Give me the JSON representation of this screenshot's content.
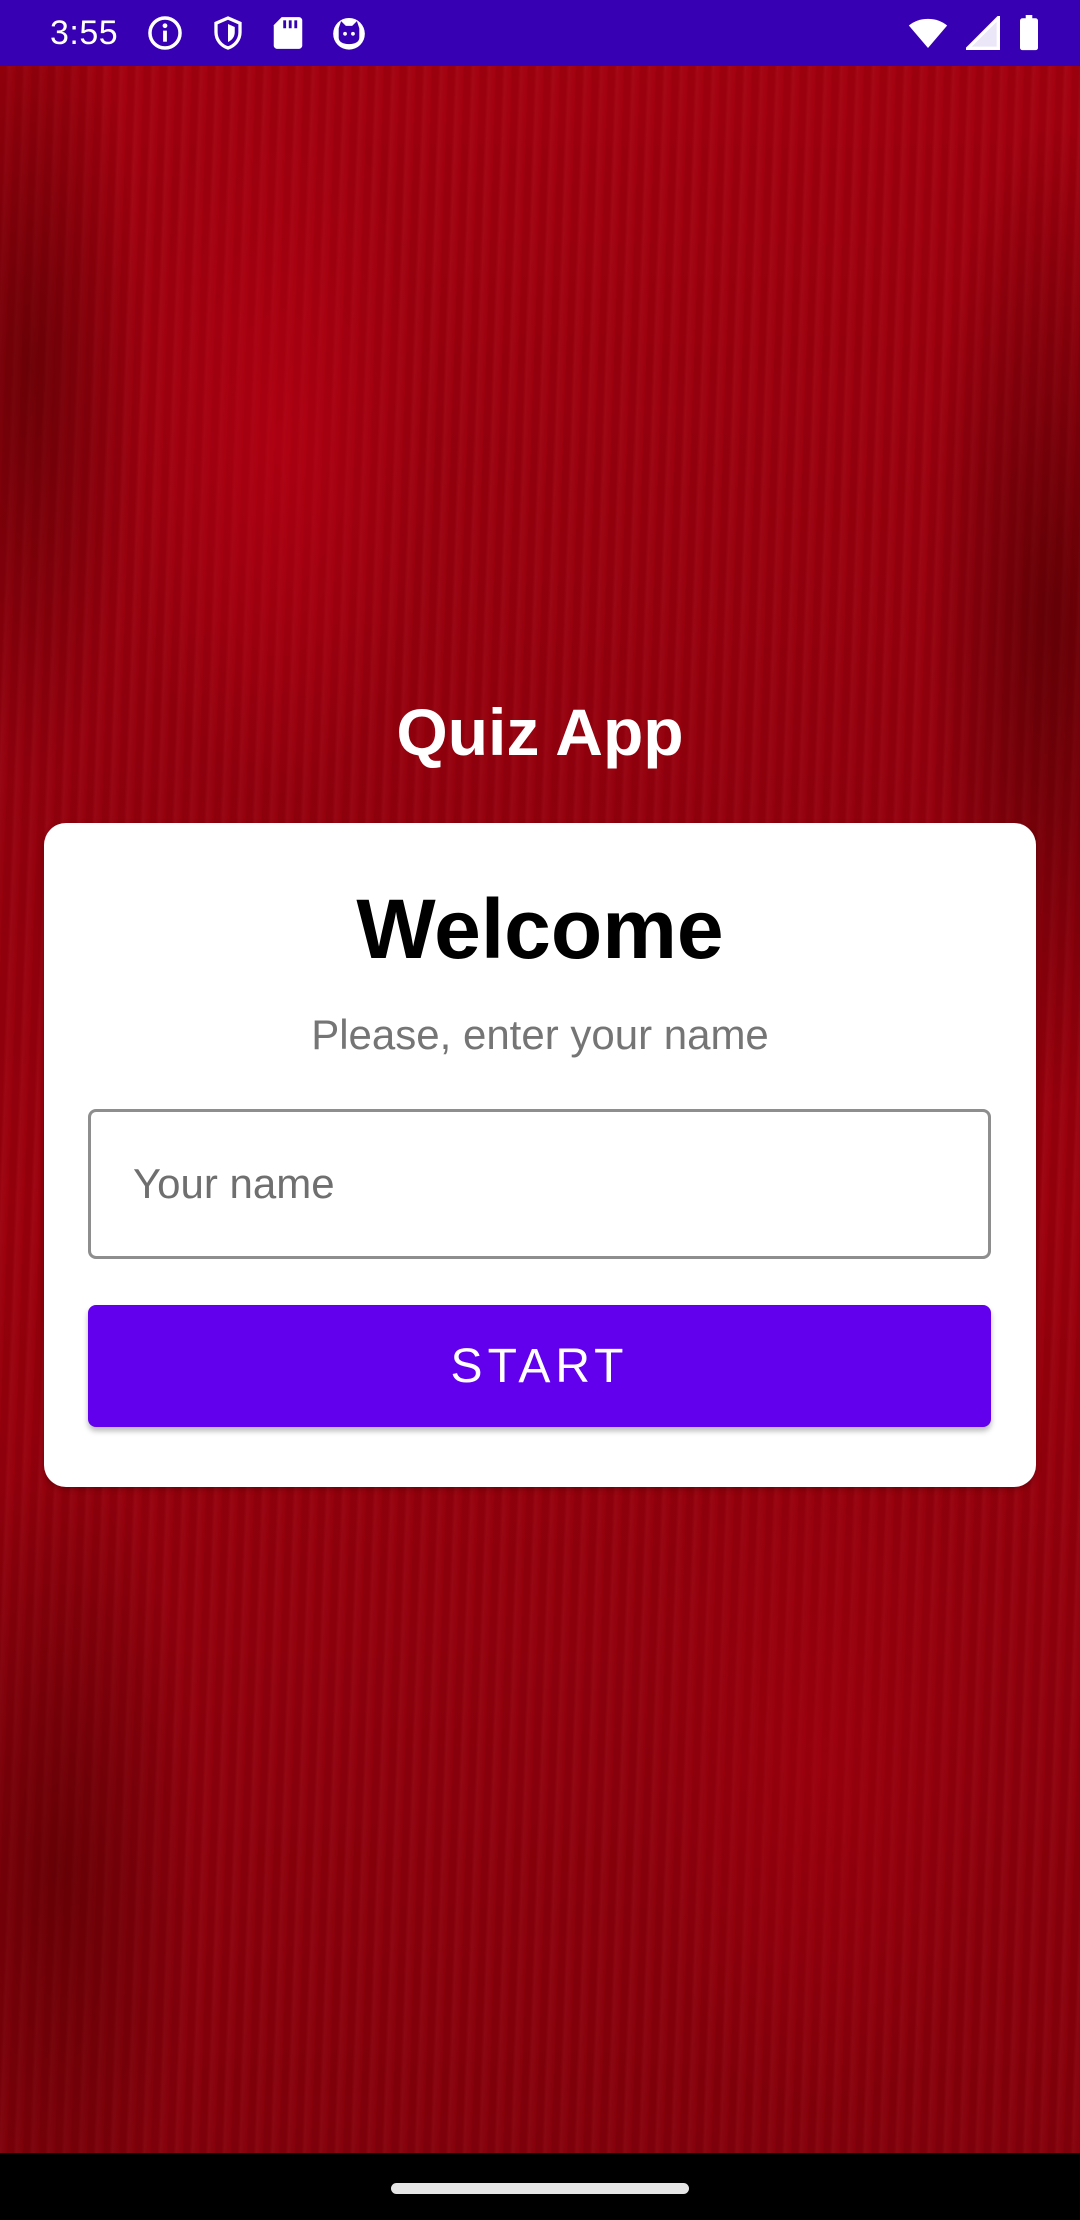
{
  "status_bar": {
    "time": "3:55",
    "background_color": "#3700b3",
    "left_icons": [
      "info-icon",
      "shield-icon",
      "sd-card-icon",
      "cat-face-icon"
    ],
    "right_icons": [
      "wifi-icon",
      "cell-signal-icon",
      "battery-icon"
    ]
  },
  "app": {
    "title": "Quiz App",
    "background_color": "#9b000c"
  },
  "card": {
    "heading": "Welcome",
    "subtitle": "Please, enter your name",
    "name_input": {
      "placeholder": "Your name",
      "value": ""
    },
    "start_button": {
      "label": "START",
      "color": "#6200ee"
    }
  },
  "navigation_bar": {
    "home_handle": "home-gesture-handle"
  }
}
